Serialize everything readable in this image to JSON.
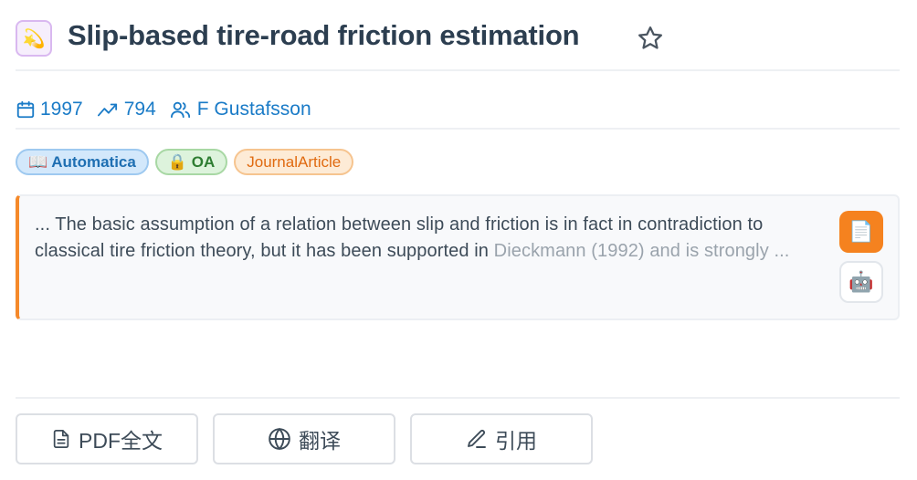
{
  "paper": {
    "emoji": "💫",
    "title": "Slip-based tire-road friction estimation"
  },
  "meta": {
    "year": "1997",
    "citations": "794",
    "authors": "F Gustafsson"
  },
  "tags": {
    "journal": "📖 Automatica",
    "access": "🔒 OA",
    "type": "JournalArticle"
  },
  "abstract": {
    "text": "... The basic assumption of a relation between slip and friction is in fact in contradiction to classical tire friction theory, but it has been supported in",
    "faded": "Dieckmann (1992) and is strongly ..."
  },
  "side_buttons": {
    "doc_icon": "📄",
    "bot_icon": "🤖"
  },
  "actions": {
    "pdf": "PDF全文",
    "translate": "翻译",
    "cite": "引用"
  },
  "colors": {
    "accent_blue": "#1a7bc7",
    "accent_orange": "#f5821f",
    "title": "#2c3e50"
  },
  "icons": {
    "star": "star-icon",
    "calendar": "calendar-icon",
    "trend": "trending-up-icon",
    "users": "users-icon",
    "file": "file-text-icon",
    "globe": "globe-icon",
    "pen": "pen-icon"
  }
}
